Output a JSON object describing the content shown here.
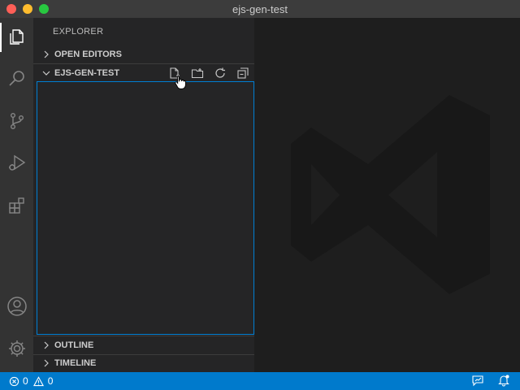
{
  "window": {
    "title": "ejs-gen-test"
  },
  "activity_bar": {
    "items": [
      {
        "name": "explorer",
        "icon": "files-icon",
        "active": true
      },
      {
        "name": "search",
        "icon": "search-icon"
      },
      {
        "name": "source-control",
        "icon": "source-control-icon"
      },
      {
        "name": "run-debug",
        "icon": "run-debug-icon"
      },
      {
        "name": "extensions",
        "icon": "extensions-icon"
      }
    ],
    "bottom": [
      {
        "name": "accounts",
        "icon": "account-icon"
      },
      {
        "name": "manage",
        "icon": "gear-icon"
      }
    ]
  },
  "sidebar": {
    "title": "EXPLORER",
    "sections": {
      "open_editors": {
        "label": "OPEN EDITORS",
        "expanded": false
      },
      "workspace": {
        "label": "EJS-GEN-TEST",
        "expanded": true,
        "actions": [
          "new-file-icon",
          "new-folder-icon",
          "refresh-icon",
          "collapse-all-icon"
        ]
      },
      "outline": {
        "label": "OUTLINE",
        "expanded": false
      },
      "timeline": {
        "label": "TIMELINE",
        "expanded": false
      }
    }
  },
  "status_bar": {
    "errors": "0",
    "warnings": "0",
    "right_icons": [
      "feedback-icon",
      "notifications-icon"
    ]
  },
  "colors": {
    "accent": "#007acc",
    "focus_border": "#007fd4",
    "activity_bar": "#333333",
    "sidebar": "#252526",
    "editor": "#1e1e1e"
  }
}
